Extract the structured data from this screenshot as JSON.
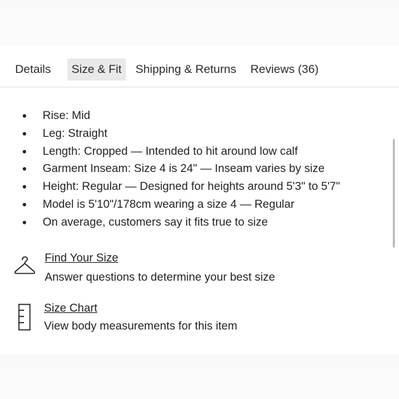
{
  "tabs": [
    {
      "label": "Details"
    },
    {
      "label": "Size & Fit",
      "active": true
    },
    {
      "label": "Shipping & Returns"
    },
    {
      "label": "Reviews (36)"
    }
  ],
  "fit_details": [
    "Rise: Mid",
    "Leg: Straight",
    "Length: Cropped — Intended to hit around low calf",
    "Garment Inseam: Size 4 is 24\" — Inseam varies by size",
    "Height: Regular — Designed for heights around 5'3\" to 5'7\"",
    "Model is 5'10\"/178cm wearing a size 4  —  Regular",
    "On average, customers say it fits true to size"
  ],
  "find_your_size": {
    "title": "Find Your Size",
    "description": "Answer questions to determine your best size",
    "icon": "hanger-icon"
  },
  "size_chart": {
    "title": "Size Chart",
    "description": "View body measurements for this item",
    "icon": "ruler-icon"
  },
  "colors": {
    "active_tab_bg": "#e9e9e9",
    "text": "#222222",
    "divider": "#e2e2e2"
  }
}
